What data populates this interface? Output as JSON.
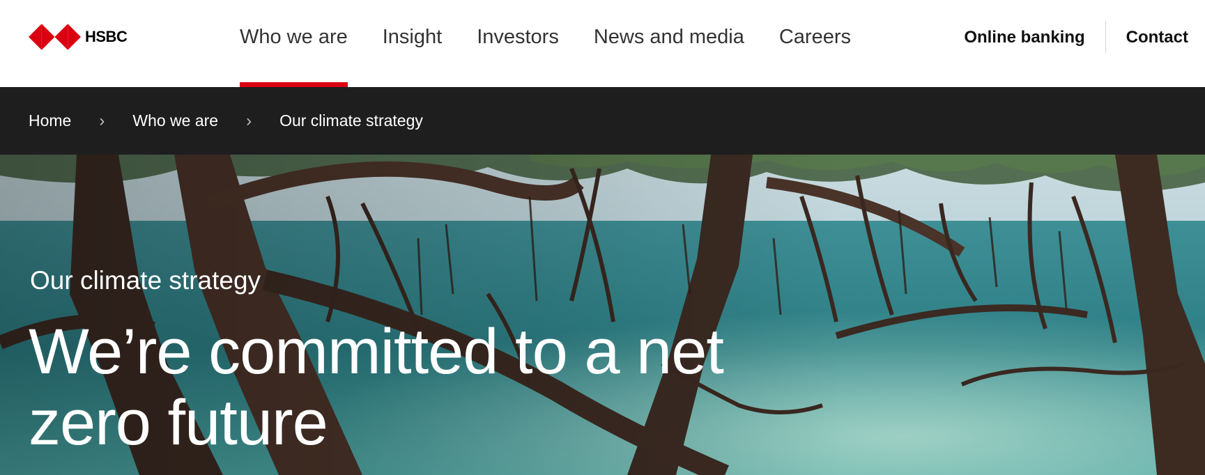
{
  "brand": {
    "name": "HSBC",
    "logo_icon": "hsbc-hexagon-logo",
    "accent_color": "#db0011"
  },
  "nav": {
    "items": [
      {
        "label": "Who we are",
        "active": true
      },
      {
        "label": "Insight",
        "active": false
      },
      {
        "label": "Investors",
        "active": false
      },
      {
        "label": "News and media",
        "active": false
      },
      {
        "label": "Careers",
        "active": false
      }
    ],
    "online_banking": "Online banking",
    "contact": "Contact"
  },
  "breadcrumb": {
    "separator_icon": "chevron-right-icon",
    "items": [
      "Home",
      "Who we are",
      "Our climate strategy"
    ]
  },
  "hero": {
    "image_subject": "mangrove-forest",
    "eyebrow": "Our climate strategy",
    "title": "We’re committed to a net zero future"
  }
}
